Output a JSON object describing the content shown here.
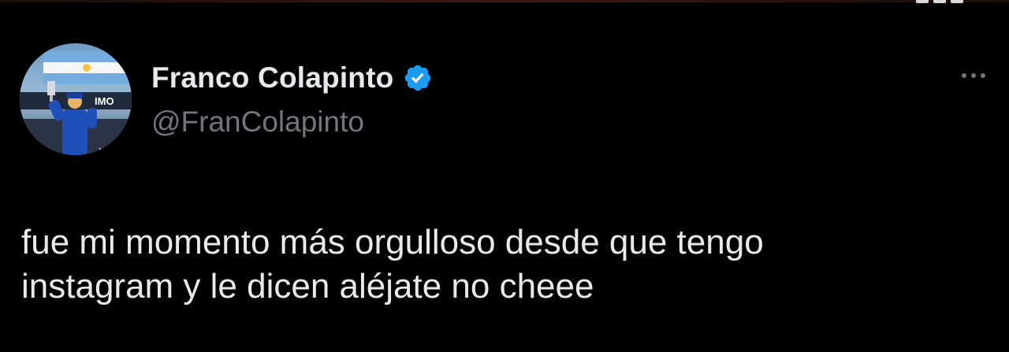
{
  "author": {
    "display_name": "Franco Colapinto",
    "handle": "@FranColapinto",
    "verified": true,
    "verified_color": "#1d9bf0",
    "avatar_icon": "avatar-photo"
  },
  "tweet": {
    "text_lines": [
      "fue mi momento más orgulloso desde que tengo",
      "instagram y le dicen aléjate no cheee"
    ]
  },
  "actions": {
    "more_icon": "more-horizontal-icon"
  },
  "theme": {
    "background": "#000000",
    "text_primary": "#e7e9ea",
    "text_secondary": "#71767b"
  }
}
